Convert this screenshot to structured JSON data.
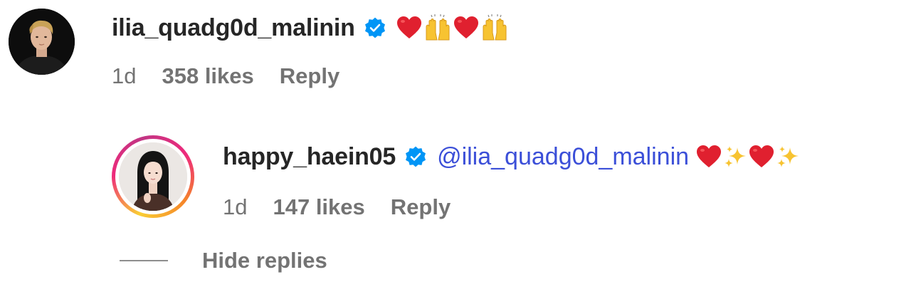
{
  "comments": [
    {
      "username": "ilia_quadg0d_malinin",
      "verified": true,
      "avatar_icon": "person-avatar-dark",
      "emojis": [
        "red-heart",
        "raising-hands",
        "red-heart",
        "raising-hands"
      ],
      "time": "1d",
      "likes": "358 likes",
      "reply_label": "Reply"
    }
  ],
  "reply": {
    "username": "happy_haein05",
    "verified": true,
    "avatar_icon": "person-avatar-story-ring",
    "mention": "@ilia_quadg0d_malinin",
    "emojis": [
      "red-heart",
      "sparkles",
      "red-heart",
      "sparkles"
    ],
    "time": "1d",
    "likes": "147 likes",
    "reply_label": "Reply"
  },
  "hide_replies_label": "Hide replies",
  "colors": {
    "text_primary": "#262626",
    "text_secondary": "#737373",
    "mention": "#3b4fd8",
    "verified_badge": "#0095f6",
    "heart": "#e0202f",
    "sparkle": "#f7c331"
  }
}
